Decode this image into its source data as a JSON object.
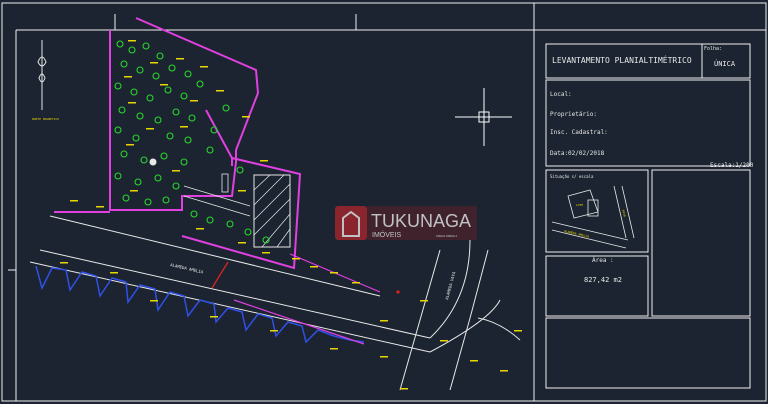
{
  "title_block": {
    "drawing_title": "LEVANTAMENTO PLANIALTIMÉTRICO",
    "sheet_label": "Folha:",
    "sheet_value": "ÚNICA",
    "local": "Local:",
    "owner": "Proprietário:",
    "cadastral": "Insc. Cadastral:",
    "date": "Data:02/02/2018",
    "scale": "Escala:1/200",
    "location_label": "Situação s/ escala",
    "area_label": "Área :",
    "area_value": "827,42 m2"
  },
  "plan": {
    "street_main": "ALAMEDA AMELIA",
    "street_side": "ALAMEDA VAYA",
    "north_note": "NORTE MAGNETICO",
    "lot_code": "LOTE",
    "mini_street": "ALAMEDA AMELIA",
    "mini_side": "VAYA"
  },
  "watermark": {
    "brand": "TUKUNAGA",
    "sub": "IMÓVEIS",
    "tag": "CRECI 00000-J"
  },
  "colors": {
    "background": "#1b2430",
    "frame": "#f0f0f0",
    "lot_boundary": "#e040e0",
    "trees": "#29d62d",
    "labels": "#e8d600",
    "sidewalk": "#3050e8",
    "brand_red": "#b5252d"
  }
}
